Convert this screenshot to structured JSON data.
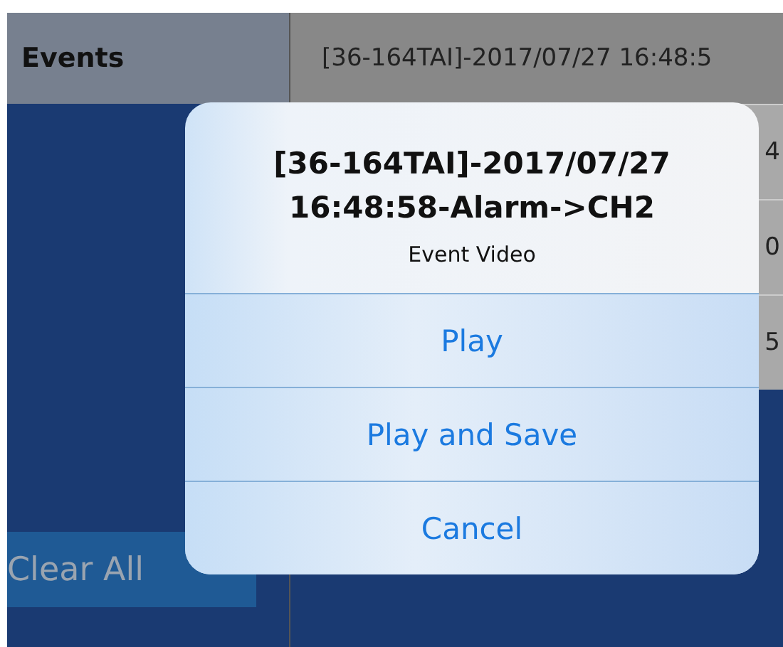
{
  "sidebar": {
    "title": "Events",
    "clear_button": "Clear All"
  },
  "event_list": {
    "header": "[36-164TAI]-2017/07/27 16:48:5",
    "rows": [
      "4",
      "0",
      "5"
    ]
  },
  "dialog": {
    "title": "[36-164TAI]-2017/07/27 16:48:58-Alarm->CH2",
    "message": "Event Video",
    "actions": [
      "Play",
      "Play and Save",
      "Cancel"
    ]
  }
}
